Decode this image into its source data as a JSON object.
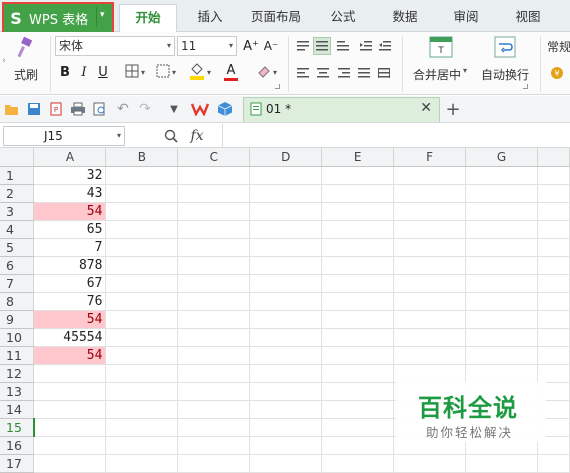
{
  "app": {
    "name": "WPS 表格",
    "logo": "S",
    "brand_color": "#43a147"
  },
  "ribbon_tabs": [
    "开始",
    "插入",
    "页面布局",
    "公式",
    "数据",
    "审阅",
    "视图"
  ],
  "active_tab": "开始",
  "ribbon": {
    "format_painter_label": "式刷",
    "font_name": "宋体",
    "font_size": "11",
    "grow_font": "A⁺",
    "shrink_font": "A⁻",
    "bold": "B",
    "italic": "I",
    "underline": "U",
    "font_color_label": "A",
    "merge_label": "合并居中",
    "wrap_label": "自动换行",
    "number_format": "常规"
  },
  "doc_tab": {
    "name": "01 *"
  },
  "formula_bar": {
    "cell_ref": "J15",
    "fx": "fx"
  },
  "sheet": {
    "columns": [
      "A",
      "B",
      "C",
      "D",
      "E",
      "F",
      "G"
    ],
    "selected_row": 15,
    "rows": [
      {
        "n": "1",
        "a": "32"
      },
      {
        "n": "2",
        "a": "43"
      },
      {
        "n": "3",
        "a": "54",
        "dup": true
      },
      {
        "n": "4",
        "a": "65"
      },
      {
        "n": "5",
        "a": "7"
      },
      {
        "n": "6",
        "a": "878"
      },
      {
        "n": "7",
        "a": "67"
      },
      {
        "n": "8",
        "a": "76"
      },
      {
        "n": "9",
        "a": "54",
        "dup": true
      },
      {
        "n": "10",
        "a": "45554"
      },
      {
        "n": "11",
        "a": "54",
        "dup": true
      },
      {
        "n": "12",
        "a": ""
      },
      {
        "n": "13",
        "a": ""
      },
      {
        "n": "14",
        "a": ""
      },
      {
        "n": "15",
        "a": ""
      },
      {
        "n": "16",
        "a": ""
      },
      {
        "n": "17",
        "a": ""
      }
    ],
    "highlight_fill": "#ffc7ce",
    "highlight_text": "#9c0006"
  },
  "watermark": {
    "title": "百科全说",
    "subtitle": "助你轻松解决"
  }
}
